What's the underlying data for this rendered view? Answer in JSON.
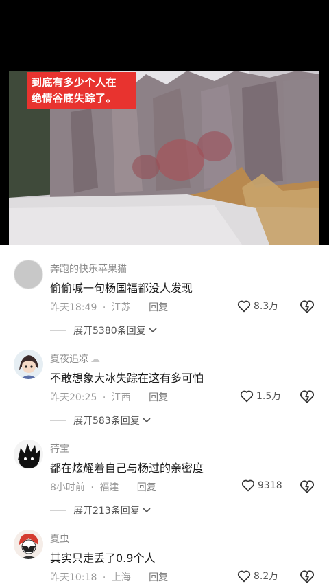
{
  "video": {
    "caption_line1": "到底有多少个人在",
    "caption_line2": "绝情谷底失踪了。"
  },
  "comments": [
    {
      "avatar": "grey-circle-avatar",
      "username": "奔跑的快乐苹果猫",
      "text": "偷偷喊一句杨国福都没人发现",
      "time": "昨天18:49",
      "location": "江苏",
      "reply_label": "回复",
      "likes": "8.3万",
      "expand_label": "展开5380条回复"
    },
    {
      "avatar": "cartoon-girl-avatar",
      "username": "夏夜追凉",
      "username_suffix": "☁",
      "text": "不敢想象大冰失踪在这有多可怕",
      "time": "昨天20:25",
      "location": "江西",
      "reply_label": "回复",
      "likes": "1.5万",
      "expand_label": "展开583条回复"
    },
    {
      "avatar": "black-spiky-avatar",
      "username": "荇宝",
      "text": "都在炫耀着自己与杨过的亲密度",
      "time": "8小时前",
      "location": "福建",
      "reply_label": "回复",
      "likes": "9318",
      "expand_label": "展开213条回复"
    },
    {
      "avatar": "red-helmet-avatar",
      "username": "夏虫",
      "text": "其实只走丢了0.9个人",
      "time": "昨天10:18",
      "location": "上海",
      "reply_label": "回复",
      "likes": "8.2万"
    }
  ],
  "separator": "·"
}
